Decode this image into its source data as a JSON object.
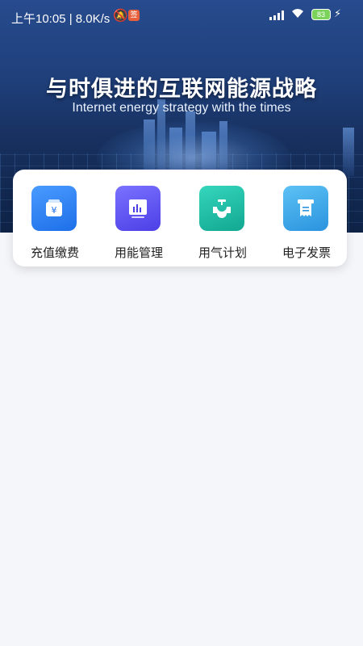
{
  "status_bar": {
    "time": "上午10:05 | 8.0K/s",
    "app_badge": "签",
    "battery": "83"
  },
  "banner": {
    "title": "与时俱进的互联网能源战略",
    "subtitle": "Internet energy strategy with the times"
  },
  "menu": [
    {
      "label": "充值缴费",
      "icon": "recharge-icon",
      "color": "#2f7ff0"
    },
    {
      "label": "用能管理",
      "icon": "energy-chart-icon",
      "color": "#5b52f0"
    },
    {
      "label": "用气计划",
      "icon": "gas-valve-icon",
      "color": "#1fbfa8"
    },
    {
      "label": "电子发票",
      "icon": "invoice-icon",
      "color": "#3aa7e8"
    }
  ]
}
